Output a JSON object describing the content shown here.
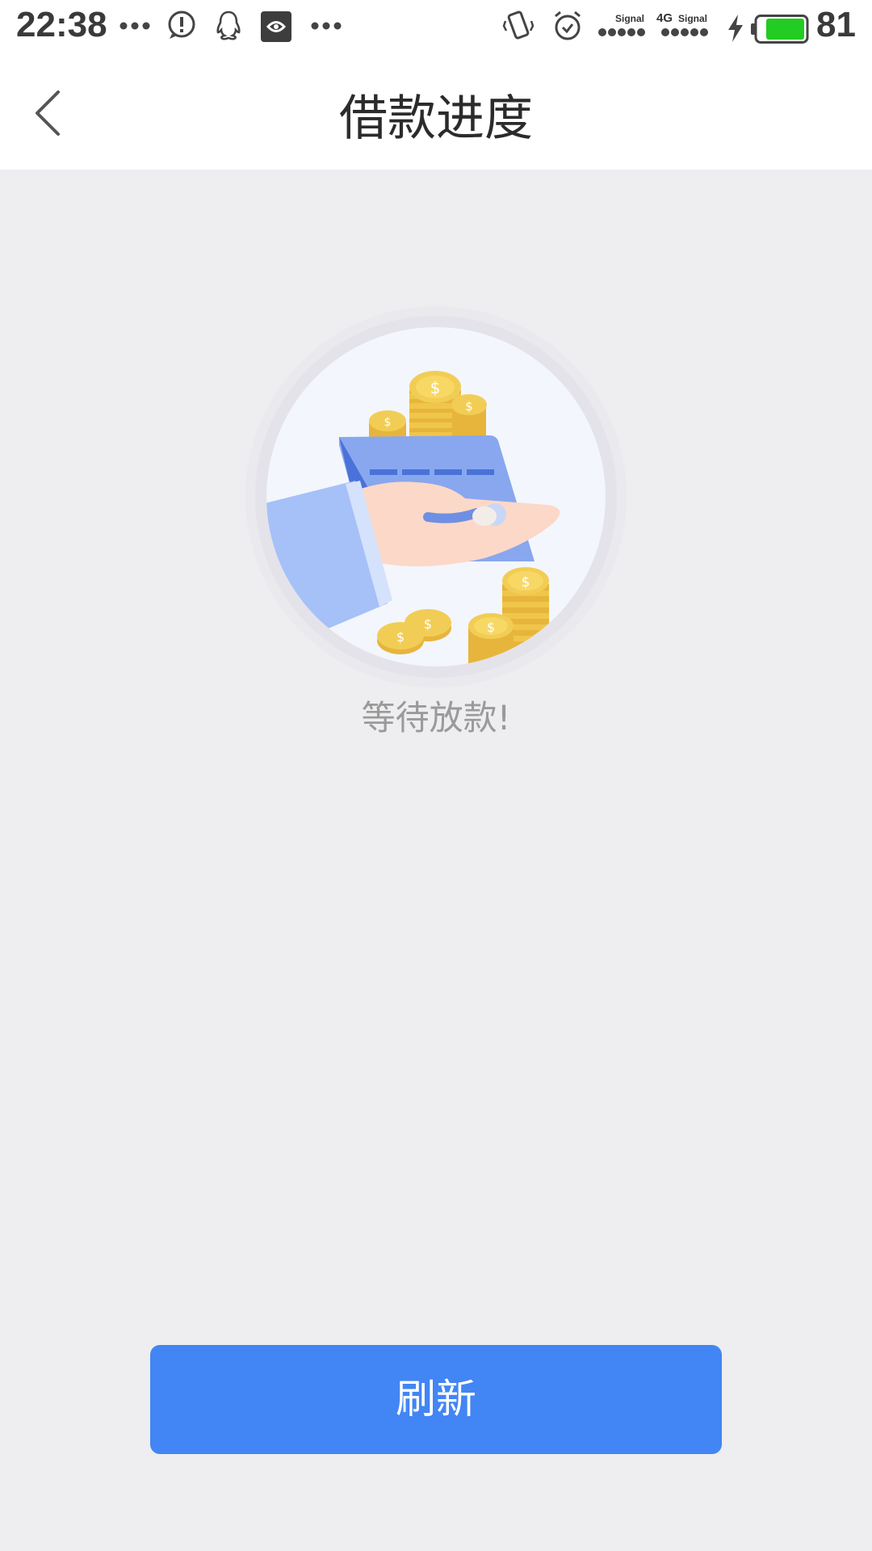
{
  "status_bar": {
    "time": "22:38",
    "battery_percent": "81",
    "signal_label_1": "Signal",
    "signal_label_2": "4G",
    "signal_label_3": "Signal",
    "icons": [
      "more-dots-icon",
      "alert-icon",
      "qq-icon",
      "app-icon",
      "more-dots-icon",
      "vibrate-icon",
      "alarm-icon",
      "signal-icon",
      "signal-4g-icon",
      "charging-icon",
      "battery-icon"
    ],
    "battery_color": "#22cc22"
  },
  "header": {
    "title": "借款进度",
    "back_icon": "chevron-left-icon"
  },
  "main": {
    "illustration": "hand-card-coins-illustration",
    "status_text": "等待放款!"
  },
  "actions": {
    "refresh_label": "刷新"
  },
  "colors": {
    "accent": "#4285f4",
    "background": "#eeedf0",
    "coin": "#f2c94c"
  }
}
